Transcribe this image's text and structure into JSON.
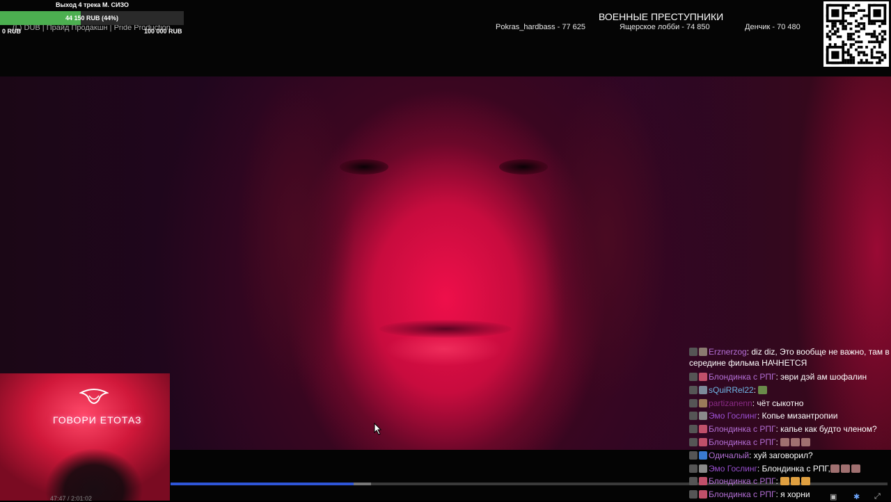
{
  "goal": {
    "title": "Выход 4 трека М. СИЗО",
    "progress_text": "44 150 RUB (44%)",
    "progress_fraction": 0.44,
    "min_label": "0 RUB",
    "max_label": "100 000 RUB"
  },
  "ticker_text": "(L) DUB | Прайд Продакшн | Pride Production",
  "leaderboard": {
    "title": "ВОЕННЫЕ ПРЕСТУПНИКИ",
    "entries": [
      "Pokras_hardbass - 77 625",
      "Ящерское лобби - 74 850",
      "Денчик - 70 480"
    ]
  },
  "webcam": {
    "neon_text": "ГОВОРИ ЕТОТАЗ",
    "timestamp": "47:47 / 2:01:02"
  },
  "player": {
    "progress_fraction": 0.255,
    "buffer_fraction": 0.28
  },
  "chat": {
    "messages": [
      {
        "user": "Erznerzog",
        "color": "#b46fd6",
        "text": "diz diz, Это вообще не важно, там в середине фильма НАЧНЕТСЯ",
        "badge": "#8a7a70"
      },
      {
        "user": "Блондинка с РПГ",
        "color": "#b46fd6",
        "text": "эври дэй ам шофалин",
        "badge": "#c0506a"
      },
      {
        "user": "sQuiRRel22",
        "color": "#6fb7e6",
        "text": "",
        "badge": "#7c8a9a"
      },
      {
        "user": "partizanenn",
        "color": "#8a2b86",
        "text": "чёт сыкотно",
        "badge": "#9a7a5a"
      },
      {
        "user": "Эмо Гослинг",
        "color": "#9a4fd0",
        "text": "Копье мизантропии",
        "badge": "#8a8a8a"
      },
      {
        "user": "Блондинка с РПГ",
        "color": "#b46fd6",
        "text": "капье как будто членом?",
        "badge": "#c0506a"
      },
      {
        "user": "Блондинка с РПГ",
        "color": "#b46fd6",
        "text": "",
        "badge": "#c0506a"
      },
      {
        "user": "Одичалый",
        "color": "#b46fd6",
        "text": "хуй заговорил?",
        "badge": "#3a7ad0"
      },
      {
        "user": "Эмо Гослинг",
        "color": "#9a4fd0",
        "text": "Блондинка с РПГ,",
        "badge": "#8a8a8a"
      },
      {
        "user": "Блондинка с РПГ",
        "color": "#b46fd6",
        "text": "",
        "badge": "#c0506a"
      },
      {
        "user": "Блондинка с РПГ",
        "color": "#b46fd6",
        "text": "я хорни",
        "badge": "#c0506a"
      }
    ]
  }
}
